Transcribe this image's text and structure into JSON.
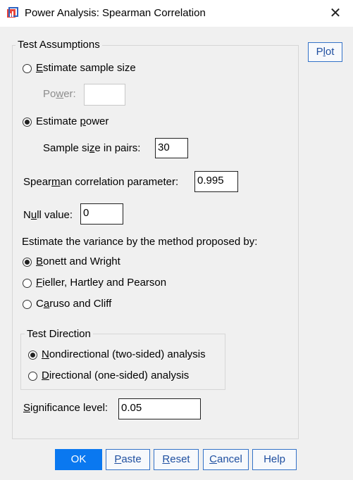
{
  "window": {
    "title": "Power Analysis: Spearman Correlation",
    "close_glyph": "✕"
  },
  "test_assumptions": {
    "group_label": "Test Assumptions",
    "estimate_sample_size": {
      "pre": "",
      "u": "E",
      "post": "stimate sample size",
      "selected": false
    },
    "power": {
      "pre": "Po",
      "u": "w",
      "post": "er:",
      "value": "",
      "enabled": false
    },
    "estimate_power": {
      "pre": "Estimate ",
      "u": "p",
      "post": "ower",
      "selected": true
    },
    "sample_size": {
      "pre": "Sample si",
      "u": "z",
      "post": "e in pairs:",
      "value": "30"
    },
    "spearman": {
      "pre": "Spear",
      "u": "m",
      "post": "an correlation parameter:",
      "value": "0.995"
    },
    "null_value": {
      "pre": "N",
      "u": "u",
      "post": "ll value:",
      "value": "0"
    },
    "variance_label": "Estimate the variance by the method proposed by:",
    "variance_methods": [
      {
        "pre": "",
        "u": "B",
        "post": "onett and Wright",
        "selected": true
      },
      {
        "pre": "",
        "u": "F",
        "post": "ieller, Hartley and Pearson",
        "selected": false
      },
      {
        "pre": "C",
        "u": "a",
        "post": "ruso and Cliff",
        "selected": false
      }
    ],
    "test_direction": {
      "group_label": "Test Direction",
      "options": [
        {
          "pre": "",
          "u": "N",
          "post": "ondirectional (two-sided) analysis",
          "selected": true
        },
        {
          "pre": "",
          "u": "D",
          "post": "irectional (one-sided) analysis",
          "selected": false
        }
      ]
    },
    "significance": {
      "pre": "",
      "u": "S",
      "post": "ignificance level:",
      "value": "0.05"
    }
  },
  "plot_button": {
    "pre": "P",
    "u": "l",
    "post": "ot"
  },
  "buttons": {
    "ok": "OK",
    "paste": {
      "pre": "",
      "u": "P",
      "post": "aste"
    },
    "reset": {
      "pre": "",
      "u": "R",
      "post": "eset"
    },
    "cancel": {
      "pre": "",
      "u": "C",
      "post": "ancel"
    },
    "help": "Help"
  },
  "colors": {
    "accent": "#0a78f0",
    "button_border": "#3372c8"
  }
}
